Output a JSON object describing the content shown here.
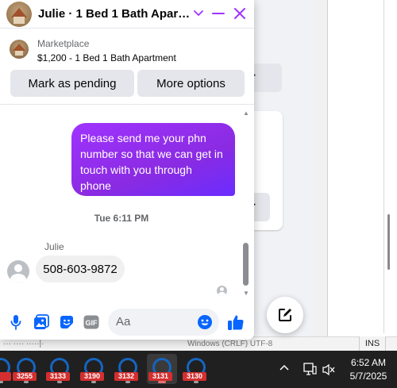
{
  "chat": {
    "title": "Julie · 1 Bed 1 Bath Apartm...",
    "listing": {
      "source": "Marketplace",
      "title": "$1,200 - 1 Bed 1 Bath Apartment",
      "actions": {
        "pending": "Mark as pending",
        "more": "More options"
      }
    },
    "messages": [
      {
        "from": "me",
        "text": "Please send me your phn number so that we can get in touch with you through phone"
      },
      {
        "from": "Julie",
        "text": "508-603-9872"
      }
    ],
    "timestamp": "Tue 6:11 PM",
    "composer": {
      "placeholder": "Aa"
    }
  },
  "background": {
    "status_left": "··· ···· ·····|·",
    "status_mid": "Windows (CRLF)    UTF-8",
    "ins": "INS"
  },
  "taskbar": {
    "apps": [
      "3255",
      "3133",
      "3190",
      "3132",
      "3131",
      "3130"
    ],
    "active_index": 4,
    "clock": {
      "time": "6:52 AM",
      "date": "5/7/2025"
    }
  },
  "colors": {
    "accent": "#a033ff",
    "brand_blue": "#0866ff",
    "taskbar": "#202020"
  }
}
